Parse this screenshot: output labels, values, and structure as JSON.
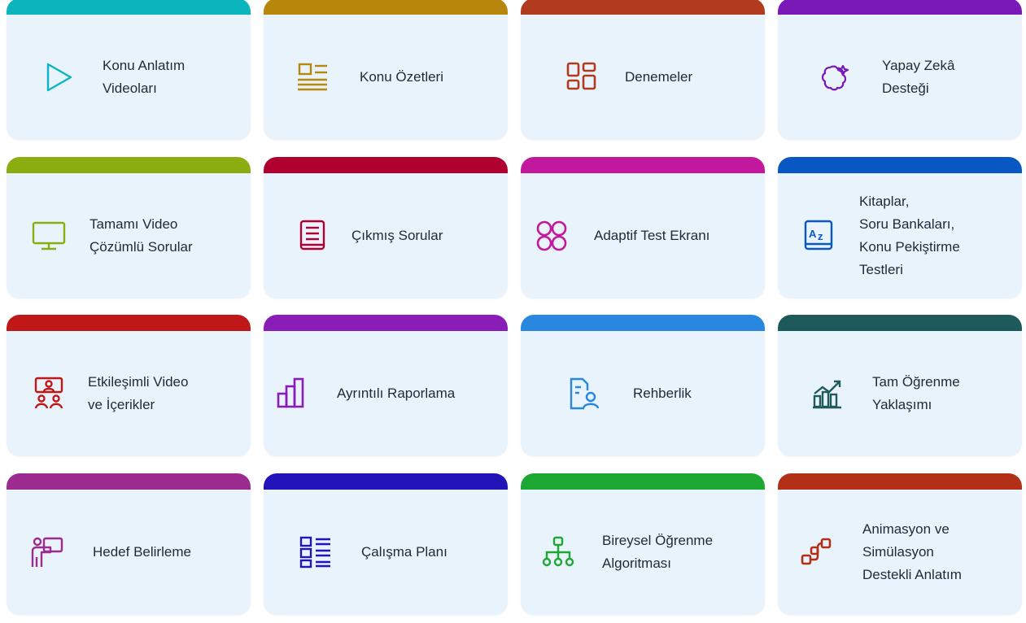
{
  "cards": [
    {
      "label": "Konu Anlatım\nVideoları",
      "color": "#0ab5be",
      "icon": "play-icon"
    },
    {
      "label": "Konu Özetleri",
      "color": "#b8860b",
      "icon": "summary-icon"
    },
    {
      "label": "Denemeler",
      "color": "#b23a1f",
      "icon": "dashboard-icon"
    },
    {
      "label": "Yapay Zekâ\nDesteği",
      "color": "#7b18b8",
      "icon": "ai-brain-icon"
    },
    {
      "label": "Tamamı Video\nÇözümlü Sorular",
      "color": "#8cad0f",
      "icon": "monitor-icon"
    },
    {
      "label": "Çıkmış Sorular",
      "color": "#b0002f",
      "icon": "book-icon"
    },
    {
      "label": "Adaptif Test Ekranı",
      "color": "#c2189d",
      "icon": "circles-icon"
    },
    {
      "label": "Kitaplar,\nSoru Bankaları,\nKonu Pekiştirme\nTestleri",
      "color": "#0957c3",
      "icon": "az-book-icon"
    },
    {
      "label": "Etkileşimli Video\nve İçerikler",
      "color": "#c01818",
      "icon": "presentation-icon"
    },
    {
      "label": "Ayrıntılı Raporlama",
      "color": "#8a1db8",
      "icon": "bar-chart-icon"
    },
    {
      "label": "Rehberlik",
      "color": "#2a87e0",
      "icon": "guidance-icon"
    },
    {
      "label": "Tam Öğrenme\nYaklaşımı",
      "color": "#1f5a5a",
      "icon": "growth-chart-icon"
    },
    {
      "label": "Hedef Belirleme",
      "color": "#9c2a8f",
      "icon": "presenter-icon"
    },
    {
      "label": "Çalışma Planı",
      "color": "#2214b8",
      "icon": "list-icon"
    },
    {
      "label": "Bireysel Öğrenme\nAlgoritması",
      "color": "#1ca833",
      "icon": "hierarchy-icon"
    },
    {
      "label": "Animasyon ve\nSimülasyon\nDestekli Anlatım",
      "color": "#b23018",
      "icon": "workflow-icon"
    }
  ]
}
